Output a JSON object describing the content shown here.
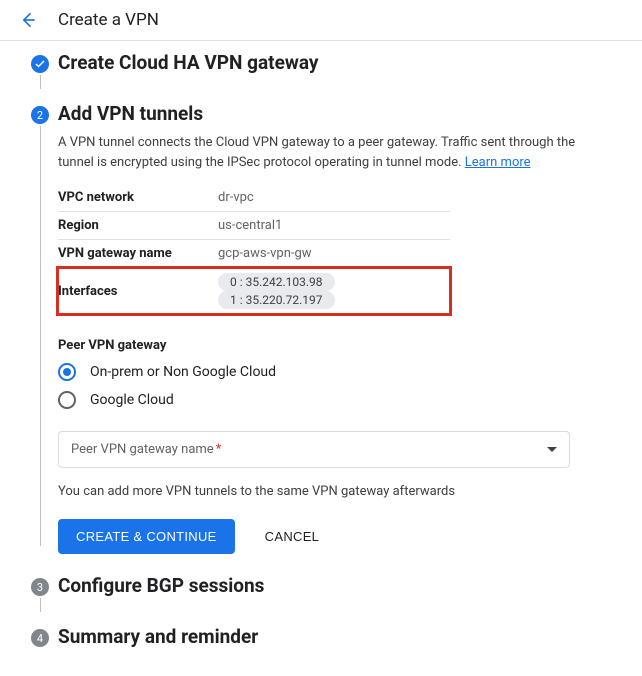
{
  "header": {
    "title": "Create a VPN"
  },
  "steps": {
    "s1": {
      "title": "Create Cloud HA VPN gateway"
    },
    "s2": {
      "number": "2",
      "title": "Add VPN tunnels",
      "desc_pre": "A VPN tunnel connects the Cloud VPN gateway to a peer gateway. Traffic sent through the tunnel is encrypted using the IPSec protocol operating in tunnel mode. ",
      "learn_more": "Learn more",
      "info": {
        "vpc_label": "VPC network",
        "vpc_value": "dr-vpc",
        "region_label": "Region",
        "region_value": "us-central1",
        "gw_label": "VPN gateway name",
        "gw_value": "gcp-aws-vpn-gw",
        "if_label": "Interfaces",
        "if0": "0 : 35.242.103.98",
        "if1": "1 : 35.220.72.197"
      },
      "peer": {
        "section_label": "Peer VPN gateway",
        "opt_onprem": "On-prem or Non Google Cloud",
        "opt_google": "Google Cloud"
      },
      "select": {
        "placeholder": "Peer VPN gateway name",
        "required_mark": "*"
      },
      "helper": "You can add more VPN tunnels to the same VPN gateway afterwards",
      "buttons": {
        "create": "CREATE & CONTINUE",
        "cancel": "CANCEL"
      }
    },
    "s3": {
      "number": "3",
      "title": "Configure BGP sessions"
    },
    "s4": {
      "number": "4",
      "title": "Summary and reminder"
    }
  }
}
